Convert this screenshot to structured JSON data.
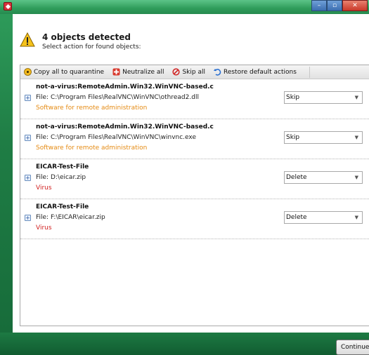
{
  "window": {
    "minimize_glyph": "–",
    "maximize_glyph": "▫",
    "close_glyph": "✕"
  },
  "header": {
    "title": "4 objects detected",
    "subtitle": "Select action for found objects:",
    "icon": "warning-icon"
  },
  "toolbar": {
    "copy_label": "Copy all to quarantine",
    "neutralize_label": "Neutralize all",
    "skip_label": "Skip all",
    "restore_label": "Restore default actions"
  },
  "objects": [
    {
      "name": "not-a-virus:RemoteAdmin.Win32.WinVNC-based.c",
      "file": "File: C:\\Program Files\\RealVNC\\WinVNC\\othread2.dll",
      "type": "Software for remote administration",
      "type_color": "#e58a12",
      "action": "Skip"
    },
    {
      "name": "not-a-virus:RemoteAdmin.Win32.WinVNC-based.c",
      "file": "File: C:\\Program Files\\RealVNC\\WinVNC\\winvnc.exe",
      "type": "Software for remote administration",
      "type_color": "#e58a12",
      "action": "Skip"
    },
    {
      "name": "EICAR-Test-File",
      "file": "File: D:\\eicar.zip",
      "type": "Virus",
      "type_color": "#d11f1f",
      "action": "Delete"
    },
    {
      "name": "EICAR-Test-File",
      "file": "File: F:\\EICAR\\eicar.zip",
      "type": "Virus",
      "type_color": "#d11f1f",
      "action": "Delete"
    }
  ],
  "footer": {
    "continue_label": "Continue"
  },
  "colors": {
    "frame_green": "#1f7d45",
    "warning_orange": "#e58a12",
    "virus_red": "#d11f1f"
  }
}
